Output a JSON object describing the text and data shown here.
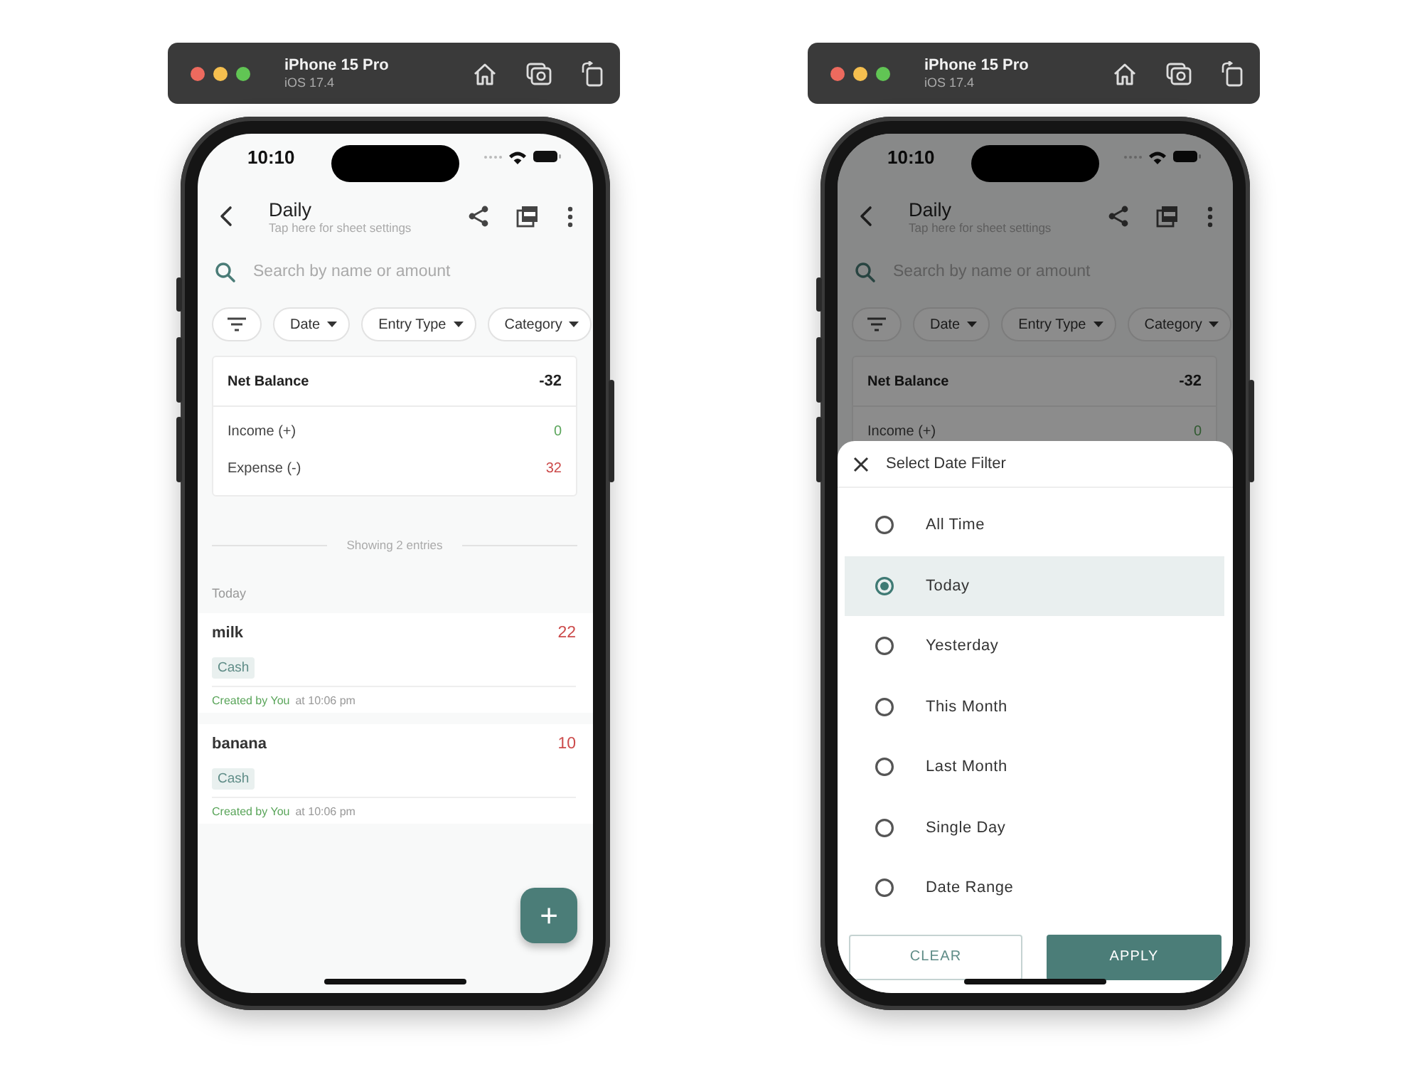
{
  "devices": [
    {
      "toolbar": {
        "name": "iPhone 15 Pro",
        "os": "iOS 17.4"
      },
      "status_bar": {
        "time": "10:10"
      },
      "app_bar": {
        "title": "Daily",
        "subtitle": "Tap here for sheet settings"
      },
      "search": {
        "placeholder": "Search by name or amount"
      },
      "filters": [
        {
          "label": "Date"
        },
        {
          "label": "Entry Type"
        },
        {
          "label": "Category"
        }
      ],
      "summary": {
        "net_label": "Net Balance",
        "net_value": "-32",
        "rows": [
          {
            "label": "Income (+)",
            "value": "0",
            "kind": "income"
          },
          {
            "label": "Expense (-)",
            "value": "32",
            "kind": "expense"
          }
        ]
      },
      "entries_caption": "Showing 2 entries",
      "groups": [
        {
          "label": "Today",
          "entries": [
            {
              "name": "milk",
              "amount": "22",
              "tag": "Cash",
              "creator": "Created by You",
              "time": "at 10:06 pm"
            },
            {
              "name": "banana",
              "amount": "10",
              "tag": "Cash",
              "creator": "Created by You",
              "time": "at 10:06 pm"
            }
          ]
        }
      ],
      "fab": "+",
      "dimmed": false
    },
    {
      "toolbar": {
        "name": "iPhone 15 Pro",
        "os": "iOS 17.4"
      },
      "status_bar": {
        "time": "10:10"
      },
      "app_bar": {
        "title": "Daily",
        "subtitle": "Tap here for sheet settings"
      },
      "search": {
        "placeholder": "Search by name or amount"
      },
      "filters": [
        {
          "label": "Date"
        },
        {
          "label": "Entry Type"
        },
        {
          "label": "Category"
        }
      ],
      "summary": {
        "net_label": "Net Balance",
        "net_value": "-32",
        "rows": [
          {
            "label": "Income (+)",
            "value": "0",
            "kind": "income"
          }
        ]
      },
      "dimmed": true,
      "sheet": {
        "title": "Select Date Filter",
        "options": [
          {
            "label": "All Time",
            "selected": false
          },
          {
            "label": "Today",
            "selected": true
          },
          {
            "label": "Yesterday",
            "selected": false
          },
          {
            "label": "This Month",
            "selected": false
          },
          {
            "label": "Last Month",
            "selected": false
          },
          {
            "label": "Single Day",
            "selected": false
          },
          {
            "label": "Date Range",
            "selected": false
          }
        ],
        "buttons": [
          {
            "label": "CLEAR",
            "kind": "outline"
          },
          {
            "label": "APPLY",
            "kind": "filled"
          }
        ]
      }
    }
  ]
}
